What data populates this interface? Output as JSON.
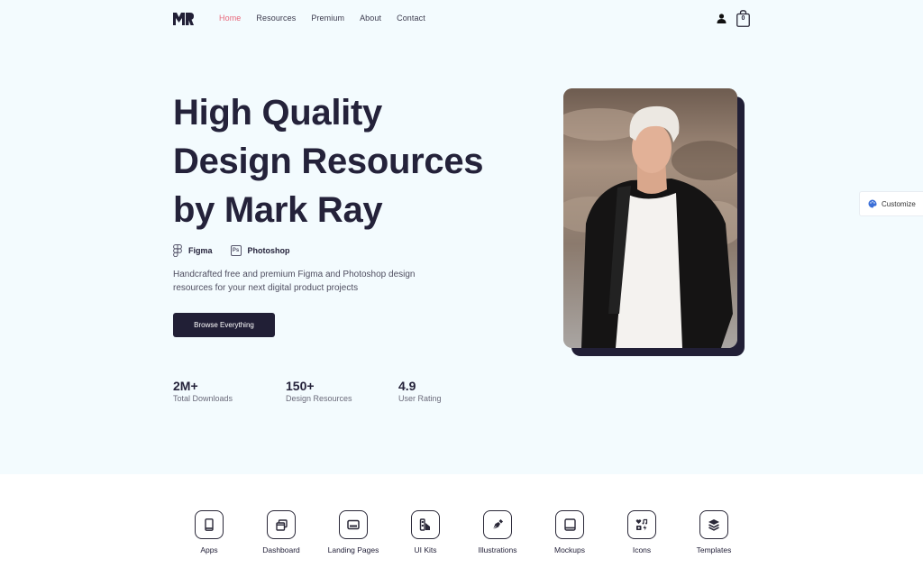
{
  "nav": {
    "logo": "MR",
    "links": [
      {
        "label": "Home",
        "active": true
      },
      {
        "label": "Resources",
        "active": false
      },
      {
        "label": "Premium",
        "active": false
      },
      {
        "label": "About",
        "active": false
      },
      {
        "label": "Contact",
        "active": false
      }
    ],
    "cart_count": "0"
  },
  "hero": {
    "headline_lines": [
      "High Quality",
      "Design Resources",
      "by Mark Ray"
    ],
    "tools": [
      {
        "icon": "figma-icon",
        "label": "Figma"
      },
      {
        "icon": "photoshop-icon",
        "label": "Photoshop",
        "badge": "Ps"
      }
    ],
    "description": "Handcrafted free and premium Figma and Photoshop design resources for your next digital product projects",
    "cta_label": "Browse Everything",
    "stats": [
      {
        "value": "2M+",
        "label": "Total Downloads"
      },
      {
        "value": "150+",
        "label": "Design Resources"
      },
      {
        "value": "4.9",
        "label": "User Rating"
      }
    ],
    "photo_alt": "Man with white hair in black cardigan and white t-shirt"
  },
  "customize": {
    "label": "Customize"
  },
  "categories": [
    {
      "label": "Apps",
      "icon": "phone-icon"
    },
    {
      "label": "Dashboard",
      "icon": "windows-icon"
    },
    {
      "label": "Landing Pages",
      "icon": "card-icon"
    },
    {
      "label": "UI Kits",
      "icon": "swatches-icon"
    },
    {
      "label": "Illustrations",
      "icon": "pen-nib-icon"
    },
    {
      "label": "Mockups",
      "icon": "tablet-icon"
    },
    {
      "label": "Icons",
      "icon": "icon-shapes-icon"
    },
    {
      "label": "Templates",
      "icon": "layers-icon"
    }
  ],
  "colors": {
    "accent": "#e8697c",
    "dark": "#211f36",
    "hero_bg": "#f3fbfe",
    "customize_icon": "#3b6fd8"
  }
}
